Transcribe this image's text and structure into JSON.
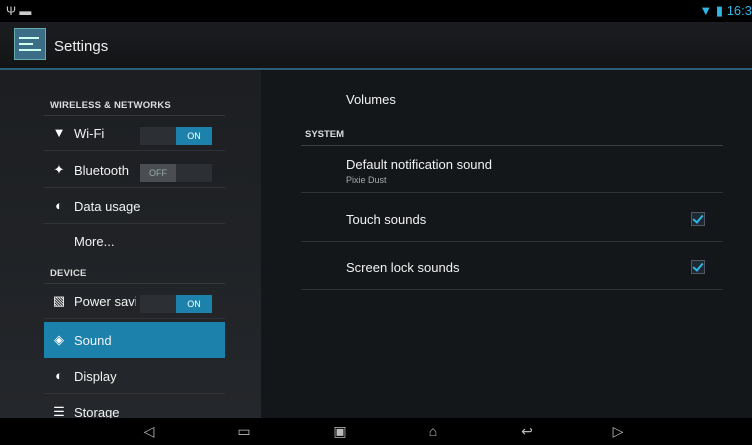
{
  "status": {
    "time": "16:3"
  },
  "app": {
    "title": "Settings"
  },
  "left": {
    "section_wireless": "WIRELESS & NETWORKS",
    "wifi": {
      "label": "Wi-Fi",
      "toggle": "ON"
    },
    "bluetooth": {
      "label": "Bluetooth",
      "toggle": "OFF"
    },
    "data_usage": "Data usage",
    "more": "More...",
    "section_device": "DEVICE",
    "power": {
      "label": "Power saving",
      "toggle": "ON"
    },
    "sound": "Sound",
    "display": "Display",
    "storage": "Storage"
  },
  "right": {
    "volumes": "Volumes",
    "section_system": "SYSTEM",
    "notification": {
      "title": "Default notification sound",
      "value": "Pixie Dust"
    },
    "touch_sounds": {
      "label": "Touch sounds",
      "checked": true
    },
    "lock_sounds": {
      "label": "Screen lock sounds",
      "checked": true
    }
  }
}
